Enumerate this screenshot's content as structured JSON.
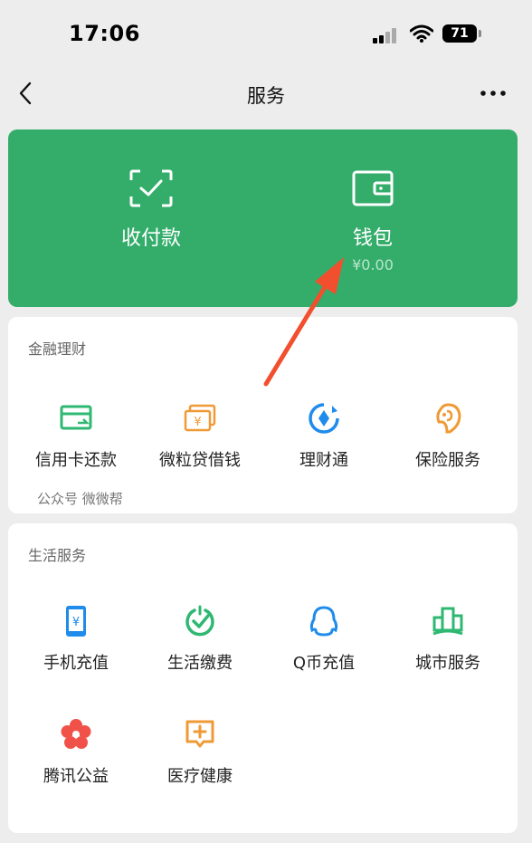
{
  "status_bar": {
    "time": "17:06",
    "battery": "71"
  },
  "nav": {
    "title": "服务"
  },
  "pay": {
    "left_label": "收付款",
    "right_label": "钱包",
    "balance": "¥0.00"
  },
  "finance": {
    "title": "金融理财",
    "items": [
      {
        "label": "信用卡还款",
        "icon": "credit-card-repay-icon"
      },
      {
        "label": "微粒贷借钱",
        "icon": "micro-loan-icon"
      },
      {
        "label": "理财通",
        "icon": "licaitong-icon"
      },
      {
        "label": "保险服务",
        "icon": "insurance-icon"
      }
    ],
    "provider": "公众号 微微帮"
  },
  "life": {
    "title": "生活服务",
    "items": [
      {
        "label": "手机充值",
        "icon": "phone-recharge-icon"
      },
      {
        "label": "生活缴费",
        "icon": "utility-payment-icon"
      },
      {
        "label": "Q币充值",
        "icon": "qq-coin-icon"
      },
      {
        "label": "城市服务",
        "icon": "city-service-icon"
      },
      {
        "label": "腾讯公益",
        "icon": "charity-flower-icon"
      },
      {
        "label": "医疗健康",
        "icon": "medical-health-icon"
      }
    ]
  },
  "colors": {
    "brand_green": "#34ad6b",
    "accent_green": "#2eb872",
    "accent_orange": "#ef9a35",
    "accent_blue": "#1f8ceb",
    "accent_red": "#f0524a",
    "arrow_red": "#f24f2e"
  }
}
